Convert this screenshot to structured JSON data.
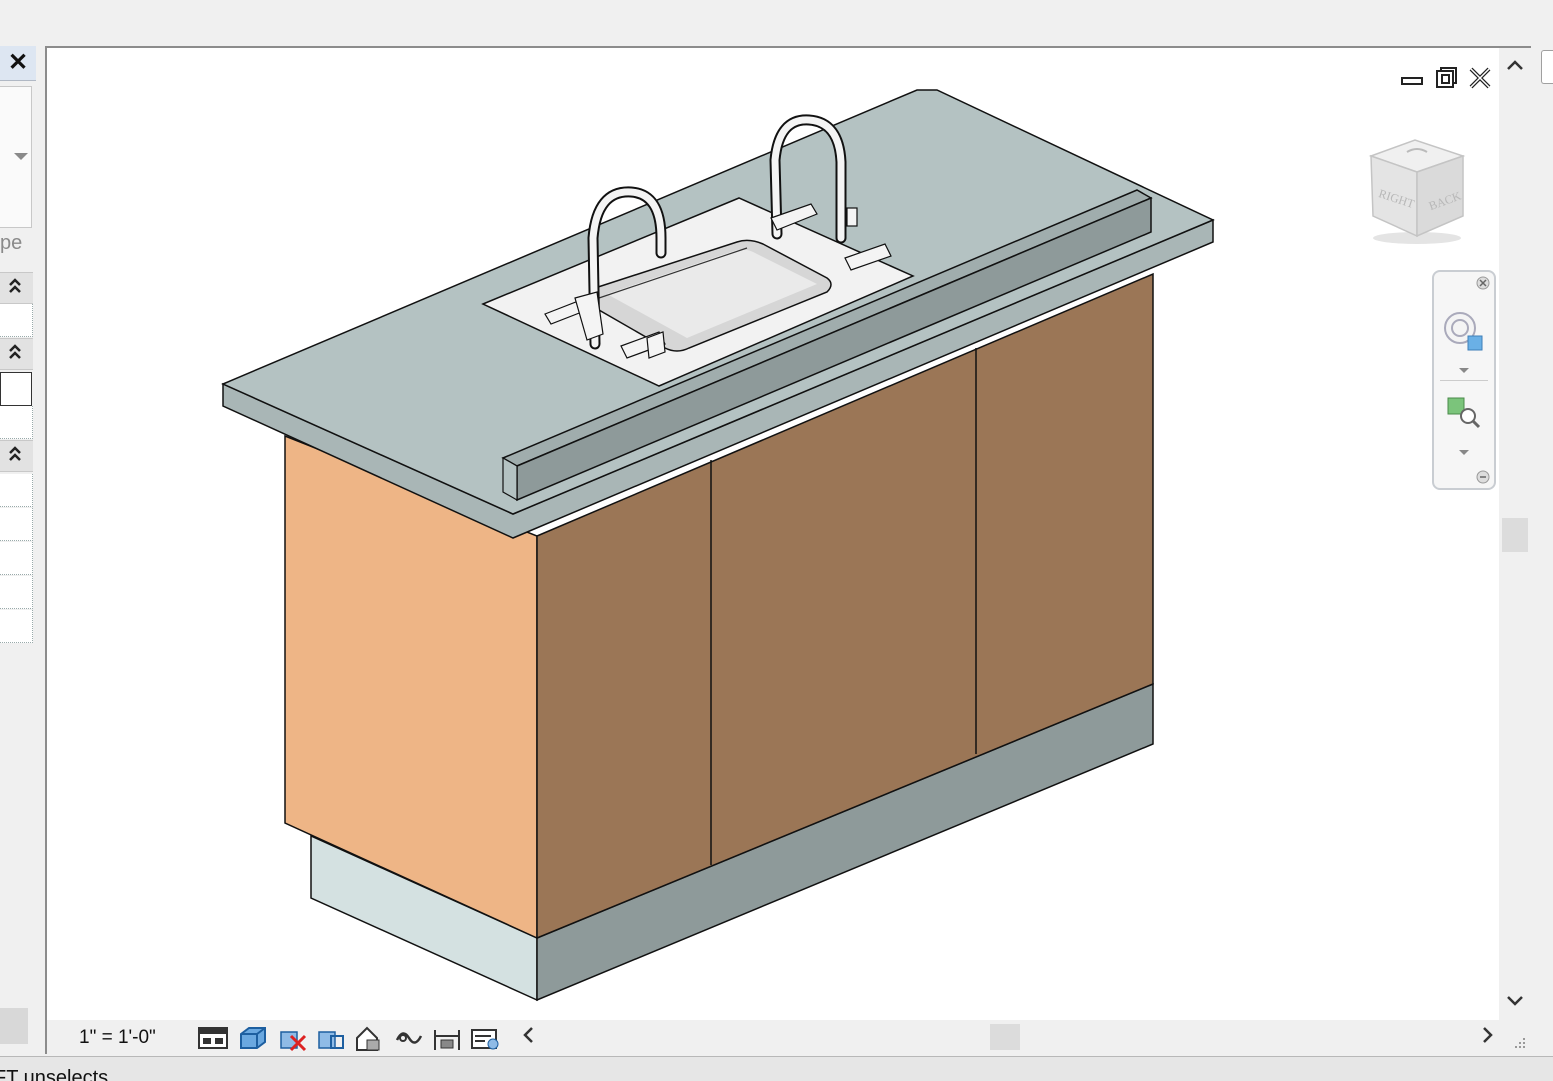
{
  "left_panel": {
    "close_label": "✕",
    "type_label_partial": "pe",
    "section_chevron": "⌃"
  },
  "view": {
    "window_controls": [
      "minimize",
      "restore",
      "close"
    ],
    "view_cube": {
      "face_right": "RIGHT",
      "face_back": "BACK"
    },
    "model": {
      "description_none": "",
      "colors": {
        "countertop": "#b4c2c2",
        "countertop_edge": "#a3b0b0",
        "backsplash": "#8e9a9a",
        "cabinet_front": "#9b7656",
        "cabinet_side": "#eeb586",
        "base_side": "#d4e1e1",
        "base_front": "#8e9a9a",
        "sink": "#eeeeee"
      }
    }
  },
  "view_control_bar": {
    "scale": "1\" = 1'-0\"",
    "icons": [
      "detail-level-icon",
      "visual-style-icon",
      "sun-path-off-icon",
      "shadows-icon",
      "show-rendering-icon",
      "crop-view-icon",
      "temporary-hide-icon",
      "reveal-hidden-icon"
    ]
  },
  "status_bar": {
    "text": "FT unselects"
  }
}
